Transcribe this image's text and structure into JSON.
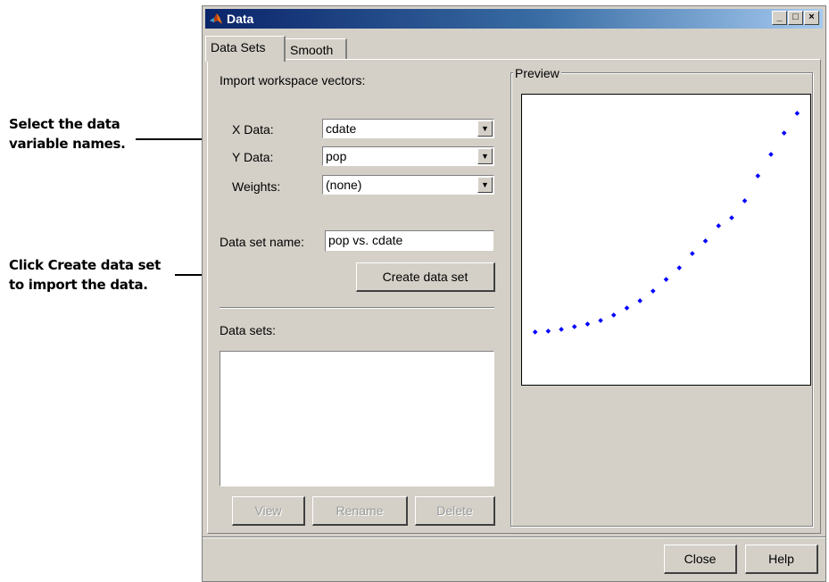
{
  "annotations": {
    "select_line1": "Select the data",
    "select_line2": "variable names.",
    "click_prefix": "Click ",
    "click_bold": "Create data set",
    "click_line2": "to import the data."
  },
  "window": {
    "title": "Data",
    "controls": {
      "minimize": "_",
      "maximize": "□",
      "close": "×"
    }
  },
  "tabs": [
    {
      "label": "Data Sets",
      "active": true
    },
    {
      "label": "Smooth",
      "active": false
    }
  ],
  "import": {
    "heading": "Import workspace vectors:",
    "x_label": "X Data:",
    "x_value": "cdate",
    "y_label": "Y Data:",
    "y_value": "pop",
    "w_label": "Weights:",
    "w_value": "(none)"
  },
  "dataset_name": {
    "label": "Data set name:",
    "value": "pop vs. cdate"
  },
  "create_button": "Create data set",
  "datasets": {
    "label": "Data sets:",
    "items": [],
    "view_button": "View",
    "rename_button": "Rename",
    "delete_button": "Delete"
  },
  "preview": {
    "title": "Preview"
  },
  "footer": {
    "close_button": "Close",
    "help_button": "Help"
  },
  "colors": {
    "dialog_bg": "#d4d0c8",
    "titlebar_start": "#0a246a",
    "titlebar_end": "#a6caf0",
    "marker": "#0000ff"
  },
  "chart_data": {
    "type": "scatter",
    "title": "",
    "xlabel": "",
    "ylabel": "",
    "grid": false,
    "x": [
      1790,
      1800,
      1810,
      1820,
      1830,
      1840,
      1850,
      1860,
      1870,
      1880,
      1890,
      1900,
      1910,
      1920,
      1930,
      1940,
      1950,
      1960,
      1970,
      1980,
      1990
    ],
    "y": [
      4,
      5,
      7,
      10,
      13,
      17,
      23,
      31,
      39,
      50,
      63,
      76,
      92,
      106,
      123,
      132,
      151,
      179,
      203,
      227,
      249
    ],
    "xlim": [
      1780,
      2000
    ],
    "ylim": [
      -55,
      270
    ],
    "marker_color": "#0000ff"
  }
}
